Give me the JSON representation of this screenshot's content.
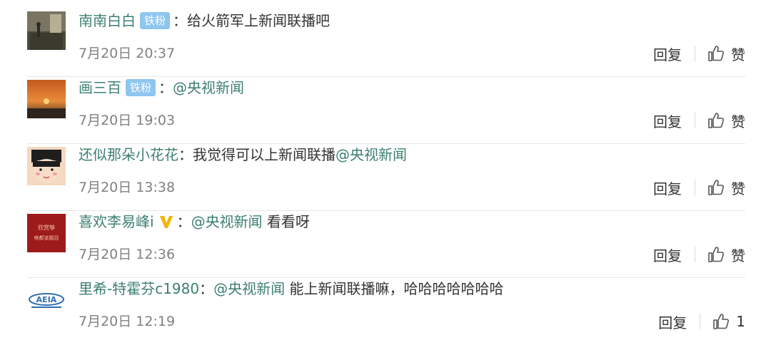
{
  "icons": {
    "thumb": "thumbs-up-icon",
    "verified": "yellow-v-verified-icon"
  },
  "colors": {
    "username": "#3c7f72",
    "fan_badge": "#8ec6ef",
    "verified": "#f5b400",
    "time": "#808080"
  },
  "comments": [
    {
      "username": "南南白白",
      "badge": "铁粉",
      "colon": "：",
      "mention": "",
      "text": "给火箭军上新闻联播吧",
      "time": "7月20日 20:37",
      "reply": "回复",
      "like": "赞"
    },
    {
      "username": "画三百",
      "badge": "铁粉",
      "colon": "：",
      "mention": "@央视新闻",
      "text": "",
      "time": "7月20日 19:03",
      "reply": "回复",
      "like": "赞"
    },
    {
      "username": "还似那朵小花花",
      "colon": "：",
      "text_before": "我觉得可以上新闻联播",
      "mention": "@央视新闻",
      "time": "7月20日 13:38",
      "reply": "回复",
      "like": "赞"
    },
    {
      "username": "喜欢李易峰i",
      "colon": "：",
      "mention": "@央视新闻",
      "text": " 看看呀",
      "time": "7月20日 12:36",
      "reply": "回复",
      "like": "赞"
    },
    {
      "username": "里希-特霍芬c1980",
      "colon": "：",
      "mention": "@央视新闻",
      "text": " 能上新闻联播嘛，哈哈哈哈哈哈哈",
      "time": "7月20日 12:19",
      "reply": "回复",
      "like": "1"
    }
  ],
  "avatars": {
    "avatar4_text_line1": "欣赏够",
    "avatar4_text_line2": "啥都该题目"
  }
}
